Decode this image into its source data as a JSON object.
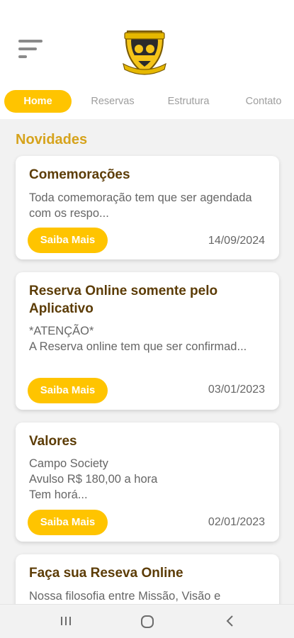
{
  "header": {
    "menu_icon": "hamburger-menu-icon",
    "logo": "club-crest-logo"
  },
  "tabs": [
    {
      "label": "Home",
      "active": true
    },
    {
      "label": "Reservas",
      "active": false
    },
    {
      "label": "Estrutura",
      "active": false
    },
    {
      "label": "Contato",
      "active": false
    }
  ],
  "section": {
    "title": "Novidades"
  },
  "cards": [
    {
      "title": "Comemorações",
      "body": "Toda comemoração tem que ser agendada com os respo...",
      "button": "Saiba Mais",
      "date": "14/09/2024"
    },
    {
      "title": "Reserva Online somente pelo Aplicativo",
      "body": "*ATENÇÃO*\nA Reserva online tem que ser confirmad...",
      "button": "Saiba Mais",
      "date": "03/01/2023"
    },
    {
      "title": "Valores",
      "body": "Campo Society\nAvulso R$ 180,00 a hora\nTem horá...",
      "button": "Saiba Mais",
      "date": "02/01/2023"
    },
    {
      "title": "Faça sua Reseva Online",
      "body": "Nossa filosofia entre Missão, Visão e"
    }
  ],
  "colors": {
    "accent": "#ffc400",
    "section_title": "#d6a31c",
    "card_title": "#5c3c06"
  },
  "navbar": {
    "recents_icon": "recent-apps-icon",
    "home_icon": "home-circle-icon",
    "back_icon": "back-chevron-icon"
  }
}
